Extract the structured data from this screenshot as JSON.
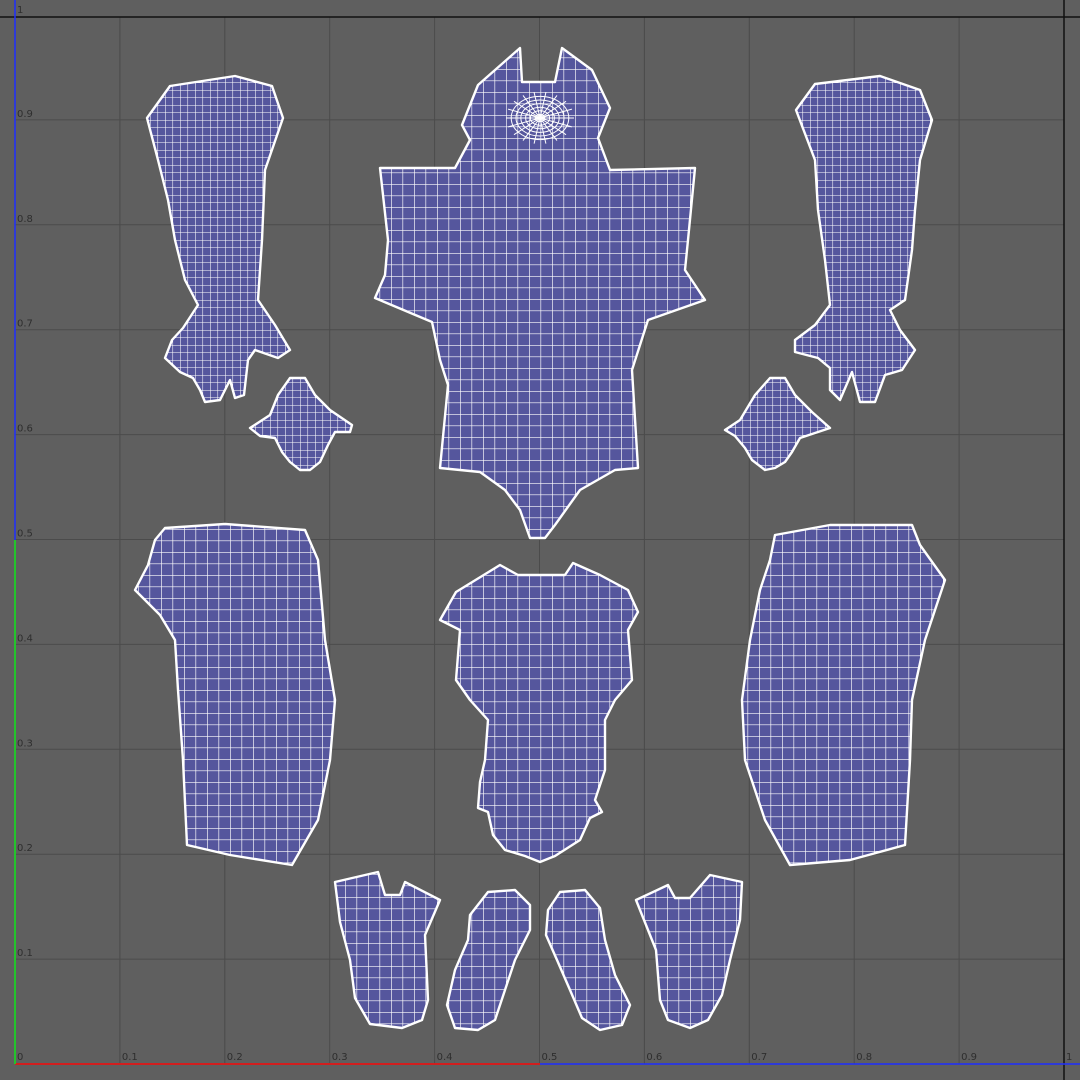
{
  "uv_editor": {
    "axis_ticks_u": [
      "0",
      "0.1",
      "0.2",
      "0.3",
      "0.4",
      "0.5",
      "0.6",
      "0.7",
      "0.8",
      "0.9",
      "1"
    ],
    "axis_ticks_v": [
      "0.1",
      "0.2",
      "0.3",
      "0.4",
      "0.5",
      "0.6",
      "0.7",
      "0.8",
      "0.9",
      "1"
    ],
    "colors": {
      "background": "#5f5f5f",
      "grid": "#4b4b4b",
      "uv_fill": "#55569d",
      "uv_wire": "#ffffff",
      "u_axis": "#d21e1e",
      "v_axis": "#23c42b",
      "frame": "#1f2fff"
    },
    "uv_shells": [
      "left-forearm-shell",
      "right-forearm-shell",
      "left-hand-shell",
      "right-hand-shell",
      "torso-head-shell",
      "left-leg-shell",
      "right-leg-shell",
      "chest-shell",
      "left-foot-top-shell",
      "left-sole-shell",
      "right-sole-shell",
      "right-foot-top-shell"
    ]
  }
}
